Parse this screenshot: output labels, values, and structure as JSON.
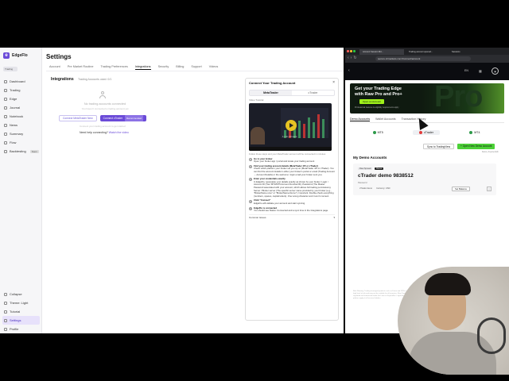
{
  "app": {
    "brand": "EdgeFlo",
    "account": "Trading",
    "nav": [
      {
        "label": "Dashboard"
      },
      {
        "label": "Trading"
      },
      {
        "label": "Edge"
      },
      {
        "label": "Journal"
      },
      {
        "label": "Notebook"
      },
      {
        "label": "News"
      },
      {
        "label": "Summary"
      },
      {
        "label": "Flow"
      },
      {
        "label": "Backtesting",
        "badge": "Soon"
      }
    ],
    "nav_bottom": [
      {
        "label": "Collapse"
      },
      {
        "label": "Theme: Light"
      },
      {
        "label": "Tutorial"
      },
      {
        "label": "Settings",
        "active": true
      },
      {
        "label": "Profile"
      }
    ],
    "page_title": "Settings",
    "tabs": [
      "Account",
      "Pre Market Routine",
      "Trading Preferences",
      "Integrations",
      "Security",
      "Billing",
      "Support",
      "Videos"
    ],
    "active_tab": "Integrations",
    "integrations": {
      "title": "Integrations",
      "subtitle": "Trading Accounts used: 0/1",
      "empty_title": "No trading accounts connected",
      "empty_desc": "You haven't connected a trading account yet",
      "btn_metatrader": "Connect MetaTrader",
      "btn_metatrader_badge": "New",
      "btn_ctrader": "Connect cTrader",
      "btn_ctrader_badge": "Recommended",
      "muted": "Connect your trading account to get started",
      "help_prefix": "Need help connecting?",
      "help_link": "Watch the video"
    },
    "connect": {
      "title": "Connect Your Trading Account",
      "tab_metatrader": "MetaTrader",
      "tab_ctrader": "cTrader",
      "video_label": "Video Tutorial",
      "video_caption": "1 min 20 secs",
      "hint": "Follow these steps and your MetaTrader account will be connected in minutes",
      "steps": [
        {
          "title": "Go to your broker",
          "text": "Open your broker app / portal and locate your trading account"
        },
        {
          "title": "Find your trading account details (MetaTrader 4/5 or cTrader)",
          "text": "Check which platform your broker set you up on (MetaTrader 4/5 or cTrader). You can find the account details in either your broker's portal or email (Trading Account → Account Details) or the welcome / login email your broker sent you."
        },
        {
          "title": "Enter your credentials exactly",
          "text": "In EdgeFlo, type/paste your details exactly as shown by your broker: Login / Account ID (Your MT4/MT5 Account Number/ID), Password (The Master Password associated with your account, which allows full trading permissions), Server / Broker server (The specific server name provided by your broker (e.g., \"BrokerName-Live\" or \"BrokerName-Demo\"). Important: Double-check everything (numbers, spaces, capital letters). One wrong character and it won't connect."
        },
        {
          "title": "Click \"Connect\"",
          "text": "EdgeFlo will validate your account and start syncing."
        },
        {
          "title": "EdgeFlo is connected",
          "text": "You should see Status: Connected and a sync time in the Integrations page."
        }
      ],
      "common": "Common issues"
    }
  },
  "browser": {
    "tabs": [
      "Account Session Mic...",
      "Trading account opened...",
      "Sessions"
    ],
    "url": "secure.ictmarkets.com/Connect/account",
    "lang": "EN",
    "promo_title": "Get your Trading Edge with Raw Pro and Pro+",
    "promo_btn": "Open an Account",
    "promo_note": "Professional features & eligibility requirements apply",
    "promo_big": "Pro",
    "account_tabs": [
      "Demo Accounts",
      "Wallet Accounts",
      "Transaction History"
    ],
    "platforms": [
      "MT5",
      "cTrader",
      "MT4"
    ],
    "active_platform": "cTrader",
    "btn_switch": "Sync to TradingView",
    "btn_open": "+ Open New Demo Account",
    "open_note": "Demo, Anyone Edit",
    "my_accounts": "My Demo Accounts",
    "demo": {
      "chip1": "Raw Spread",
      "chip2": "Demo",
      "name": "cTrader demo 9838512",
      "meta": "Password",
      "server": "cTrader demo",
      "currency": "Currency: USD",
      "btn_balance": "Set Balance",
      "more": "⋮"
    },
    "footer": "Risk Warning: Trading leveraged products such as Forex and CFDs carries a high level of risk and may not be suitable for all investors. Raw Trading Ltd is regulated and authorised under the Laws of Seychelles. Legal documents and policies apply to all account holders."
  },
  "colors": {
    "accent": "#6b4bd8",
    "browser_dark": "#202124",
    "promo_green": "#9ef01a",
    "button_green": "#4cd137"
  }
}
